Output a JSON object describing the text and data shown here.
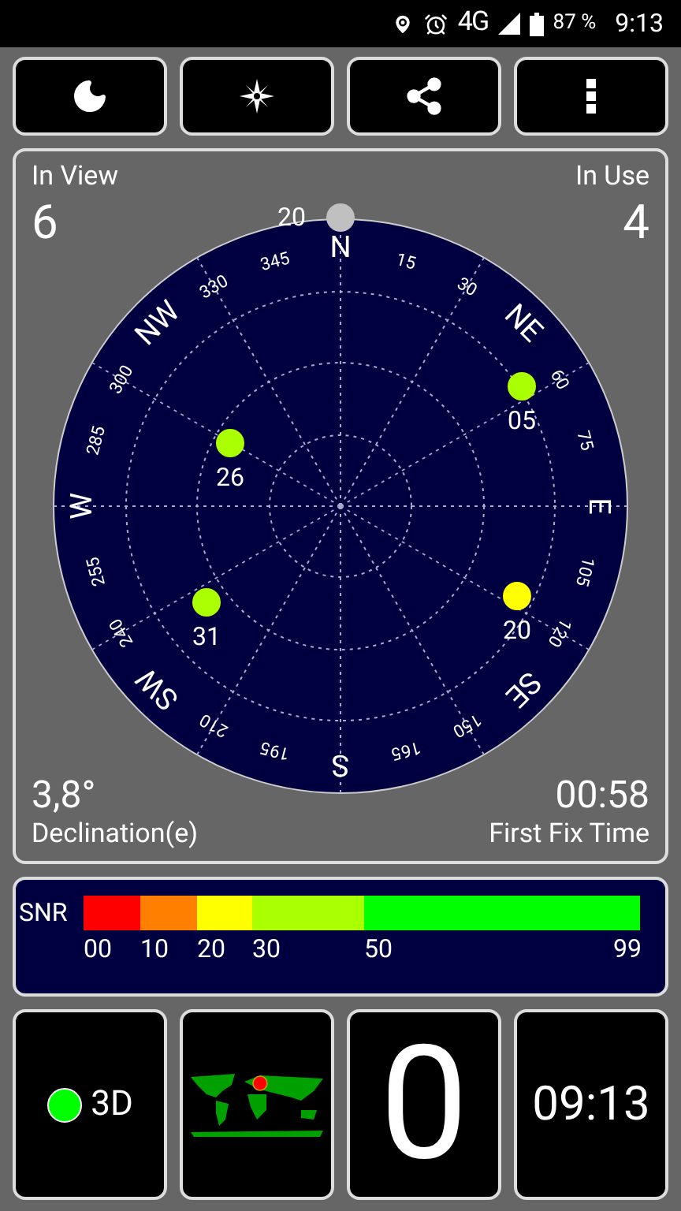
{
  "status_bar": {
    "network": "4G",
    "battery": "87 %",
    "time": "9:13"
  },
  "sky": {
    "in_view_label": "In View",
    "in_view": "6",
    "in_use_label": "In Use",
    "in_use": "4",
    "declination": "3,8°",
    "declination_label": "Declination(e)",
    "fix_time": "00:58",
    "fix_time_label": "First Fix Time",
    "compass": [
      {
        "kind": "cardinal",
        "label": "N"
      },
      {
        "kind": "degree",
        "label": "15"
      },
      {
        "kind": "degree",
        "label": "30"
      },
      {
        "kind": "cardinal",
        "label": "NE"
      },
      {
        "kind": "degree",
        "label": "60"
      },
      {
        "kind": "degree",
        "label": "75"
      },
      {
        "kind": "cardinal",
        "label": "E"
      },
      {
        "kind": "degree",
        "label": "105"
      },
      {
        "kind": "degree",
        "label": "120"
      },
      {
        "kind": "cardinal",
        "label": "SE"
      },
      {
        "kind": "degree",
        "label": "150"
      },
      {
        "kind": "degree",
        "label": "165"
      },
      {
        "kind": "cardinal",
        "label": "S"
      },
      {
        "kind": "degree",
        "label": "195"
      },
      {
        "kind": "degree",
        "label": "210"
      },
      {
        "kind": "cardinal",
        "label": "SW"
      },
      {
        "kind": "degree",
        "label": "240"
      },
      {
        "kind": "degree",
        "label": "255"
      },
      {
        "kind": "cardinal",
        "label": "W"
      },
      {
        "kind": "degree",
        "label": "285"
      },
      {
        "kind": "degree",
        "label": "300"
      },
      {
        "kind": "cardinal",
        "label": "NW"
      },
      {
        "kind": "degree",
        "label": "330"
      },
      {
        "kind": "degree",
        "label": "345"
      }
    ],
    "satellites": [
      {
        "id": "20",
        "color": "#c0c0c0"
      },
      {
        "id": "05",
        "color": "#aaff00"
      },
      {
        "id": "26",
        "color": "#aaff00"
      },
      {
        "id": "31",
        "color": "#aaff00"
      },
      {
        "id": "20",
        "color": "#ffff00"
      }
    ]
  },
  "snr": {
    "label": "SNR",
    "segments": [
      {
        "color": "#ff0000"
      },
      {
        "color": "#ff8000"
      },
      {
        "color": "#ffff00"
      },
      {
        "color": "#aaff00"
      },
      {
        "color": "#00ff00"
      }
    ],
    "ticks": [
      "00",
      "10",
      "20",
      "30",
      "50",
      "99"
    ]
  },
  "tiles": {
    "fix": "3D",
    "count": "0",
    "clock": "09:13"
  }
}
